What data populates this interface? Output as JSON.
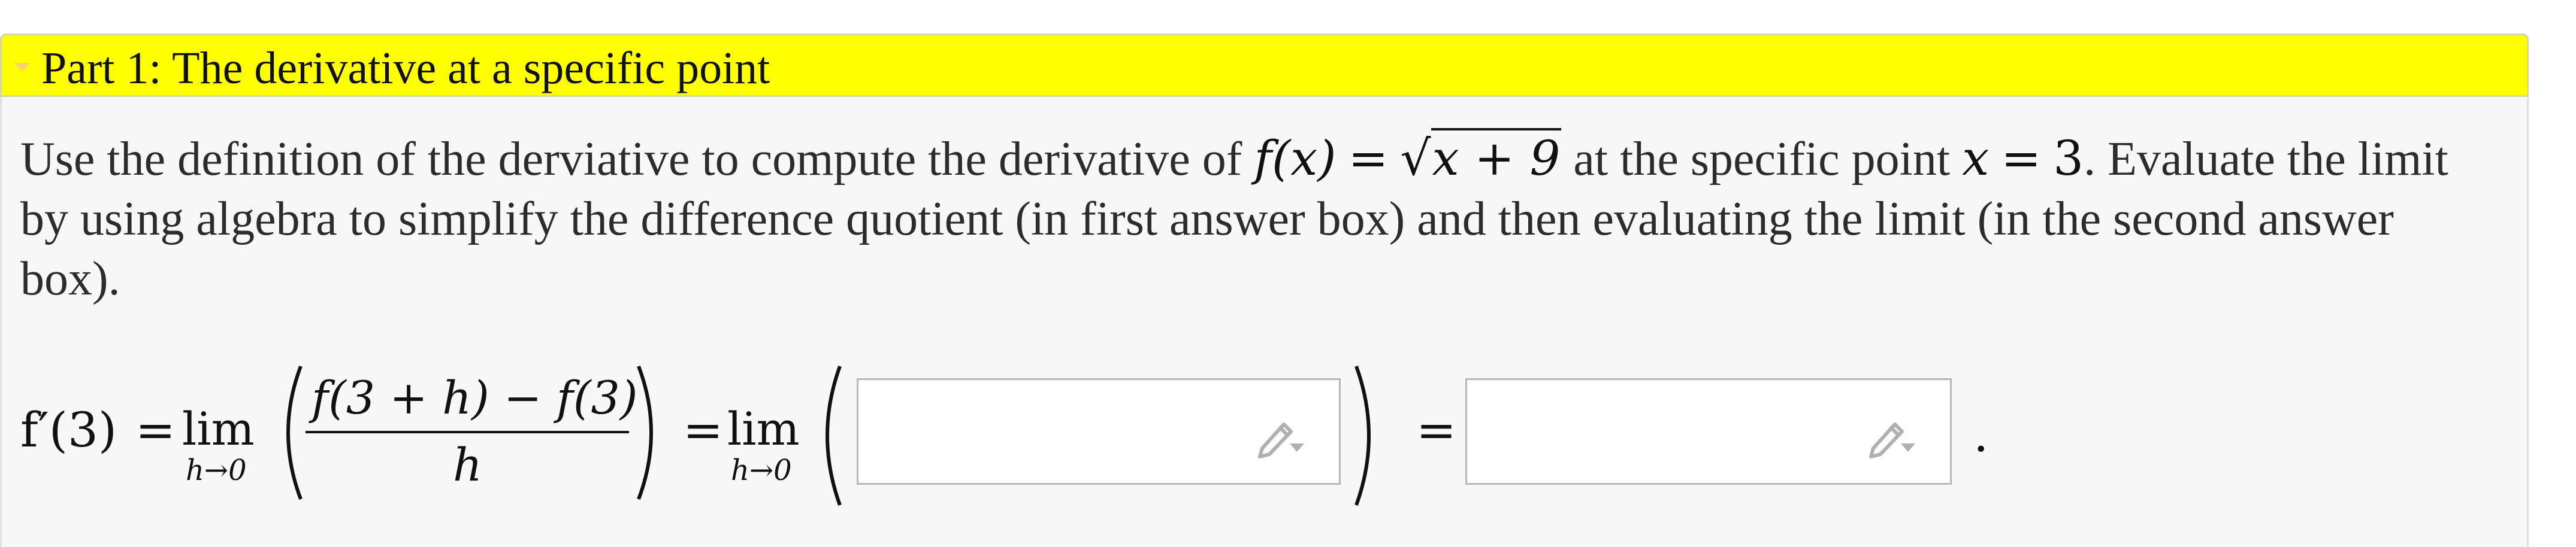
{
  "part": {
    "title": "Part 1: The derivative at a specific point",
    "accent_color": "#ffff00"
  },
  "prompt": {
    "line1_a": "Use the definition of the derviative to compute the derivative of",
    "func_lhs": "f(x)",
    "eq": "=",
    "radicand": "x + 9",
    "line1_b": "at the specific point",
    "point_var": "x",
    "point_val": "3",
    "line1_c": ". Evaluate the limit",
    "line2": "by using algebra to simplify the difference quotient (in first answer box) and then evaluating the limit (in the second answer",
    "line3": "box)."
  },
  "formula": {
    "lhs": "f′(3)",
    "eq1": "=",
    "lim": "lim",
    "lim_sub": "h→0",
    "numerator": "f(3 + h) − f(3)",
    "denominator": "h",
    "eq2": "=",
    "lim2": "lim",
    "lim2_sub": "h→0",
    "eq3": "=",
    "period": "."
  },
  "answers": [
    {
      "value": "",
      "icon": "pencil-edit-icon"
    },
    {
      "value": "",
      "icon": "pencil-edit-icon"
    }
  ]
}
